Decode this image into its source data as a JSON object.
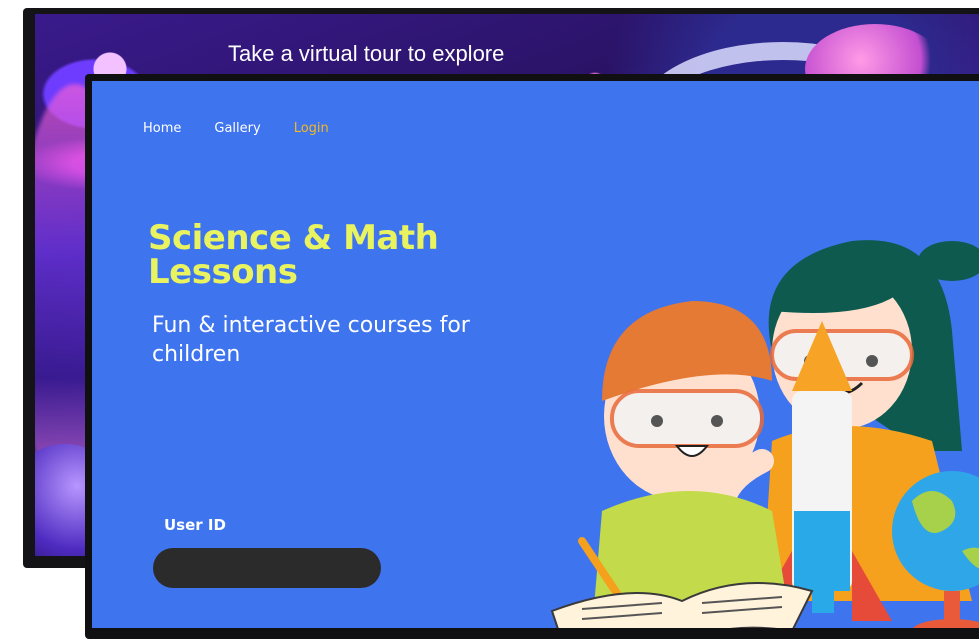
{
  "back_screen": {
    "title": "Take a virtual tour to explore"
  },
  "nav": {
    "items": [
      {
        "label": "Home",
        "active": false
      },
      {
        "label": "Gallery",
        "active": false
      },
      {
        "label": "Login",
        "active": true
      }
    ]
  },
  "hero": {
    "title": "Science & Math Lessons",
    "subtitle": "Fun & interactive courses for children"
  },
  "login": {
    "user_id_label": "User ID",
    "user_id_value": "",
    "user_id_placeholder": ""
  },
  "colors": {
    "screen_background": "#3e74ee",
    "title_accent": "#e8f35f",
    "active_nav": "#f3b91f",
    "input_background": "#2b2b2b"
  }
}
